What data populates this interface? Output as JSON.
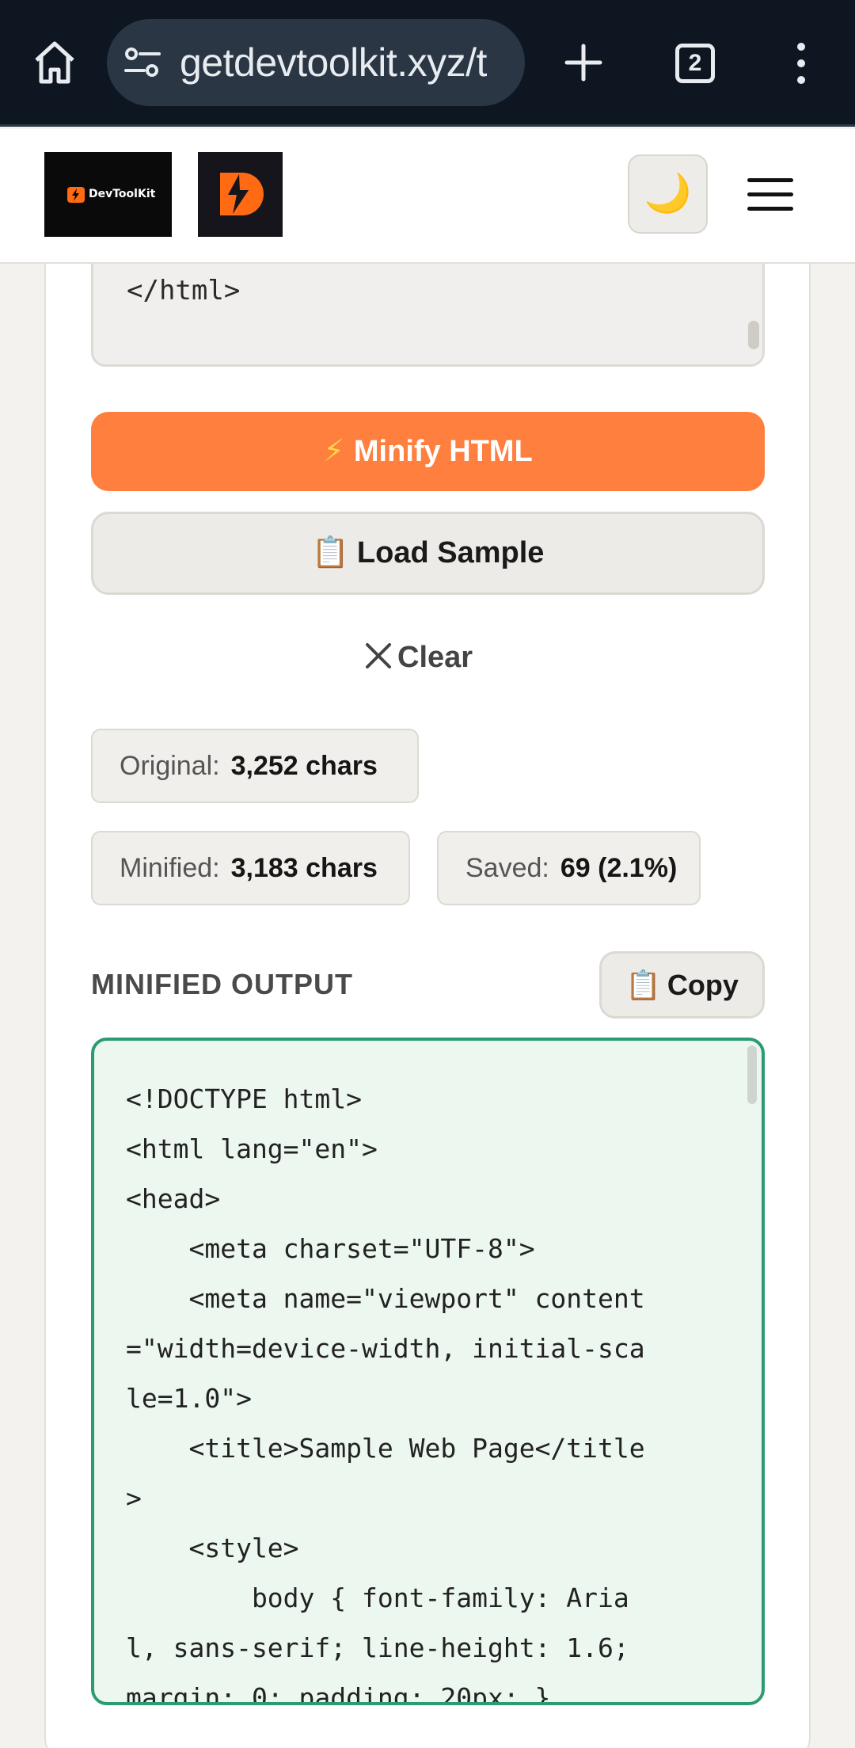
{
  "browser": {
    "url": "getdevtoolkit.xyz/t",
    "tab_count": "2",
    "icons": [
      "home-icon",
      "site-settings-icon",
      "new-tab-icon",
      "tab-switcher-icon",
      "more-icon"
    ]
  },
  "header": {
    "logo_text": "DevToolKit",
    "theme_icon": "🌙",
    "icons": [
      "logo",
      "logo-bolt-icon",
      "theme-toggle-icon",
      "menu-icon"
    ]
  },
  "input_editor": {
    "visible_tail": "</html>"
  },
  "actions": {
    "minify_icon": "⚡",
    "minify_label": "Minify HTML",
    "sample_icon": "📋",
    "sample_label": "Load Sample",
    "clear_label": "Clear"
  },
  "stats": {
    "original_label": "Original:",
    "original_value": "3,252 chars",
    "minified_label": "Minified:",
    "minified_value": "3,183 chars",
    "saved_label": "Saved:",
    "saved_value": "69 (2.1%)"
  },
  "output": {
    "title": "MINIFIED OUTPUT",
    "copy_icon": "📋",
    "copy_label": "Copy",
    "text": "<!DOCTYPE html>\n<html lang=\"en\">\n<head>\n    <meta charset=\"UTF-8\">\n    <meta name=\"viewport\" content\n=\"width=device-width, initial-sca\nle=1.0\">\n    <title>Sample Web Page</title\n>\n    <style>\n        body { font-family: Aria\nl, sans-serif; line-height: 1.6;\nmargin: 0; padding: 20px; }"
  },
  "colors": {
    "chrome_bg": "#0e1621",
    "accent": "#ff7f3f",
    "output_border": "#2c9b72",
    "output_bg": "#ecf7ef"
  }
}
